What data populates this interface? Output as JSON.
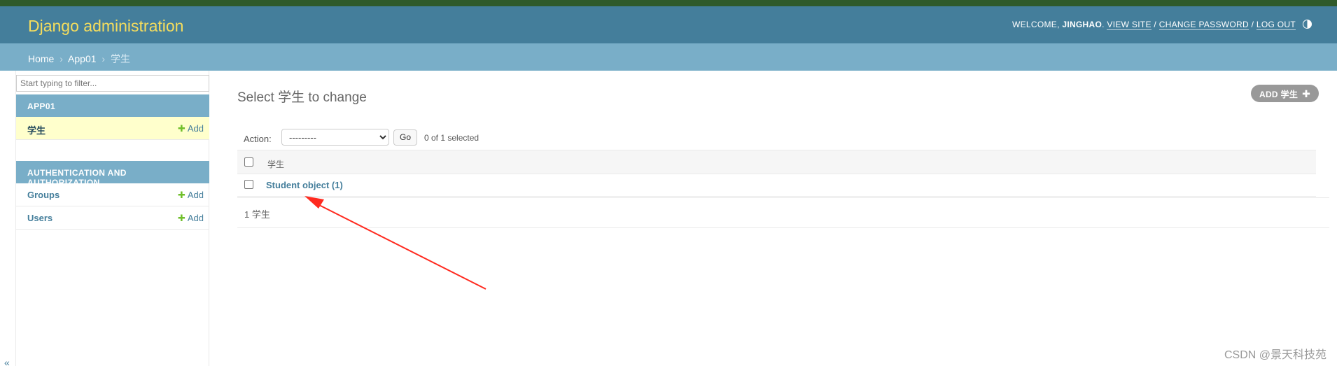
{
  "header": {
    "site_name": "Django administration",
    "welcome_text": "WELCOME, ",
    "username": "JINGHAO",
    "view_site": "VIEW SITE",
    "change_password": "CHANGE PASSWORD",
    "log_out": "LOG OUT",
    "sep": " / "
  },
  "breadcrumbs": {
    "home": "Home",
    "app": "App01",
    "model": "学生",
    "sep": "›"
  },
  "sidebar": {
    "filter_placeholder": "Start typing to filter...",
    "modules": [
      {
        "caption": "APP01",
        "items": [
          {
            "name": "学生",
            "add": "Add"
          }
        ]
      },
      {
        "caption": "AUTHENTICATION AND AUTHORIZATION",
        "items": [
          {
            "name": "Groups",
            "add": "Add"
          },
          {
            "name": "Users",
            "add": "Add"
          }
        ]
      }
    ],
    "collapse_glyph": "«"
  },
  "main": {
    "title": "Select 学生 to change",
    "add_button": "ADD 学生",
    "add_button_plus": "✚",
    "action_label": "Action:",
    "action_selected": "---------",
    "go_label": "Go",
    "selection_count": "0 of 1 selected",
    "column_header": "学生",
    "rows": [
      "Student object (1)"
    ],
    "paginator": "1 学生"
  },
  "watermark": "CSDN @景天科技苑",
  "colors": {
    "header": "#447e9b",
    "breadcrumbs": "#79aec8",
    "branding": "#f5dd5d",
    "link": "#447e9b",
    "selected_row": "#ffffcc",
    "annotation_arrow": "#ff2a1f"
  }
}
